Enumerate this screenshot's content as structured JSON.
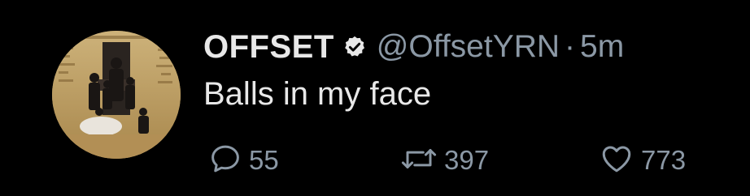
{
  "tweet": {
    "author_name": "OFFSET",
    "handle": "@OffsetYRN",
    "separator": "·",
    "timestamp": "5m",
    "verified": true,
    "text": "Balls in my face"
  },
  "actions": {
    "reply": {
      "icon": "reply-icon",
      "count": "55"
    },
    "retweet": {
      "icon": "retweet-icon",
      "count": "397"
    },
    "like": {
      "icon": "heart-icon",
      "count": "773"
    }
  },
  "colors": {
    "background": "#000000",
    "primary_text": "#e8e8e8",
    "secondary_text": "#8b98a5"
  }
}
